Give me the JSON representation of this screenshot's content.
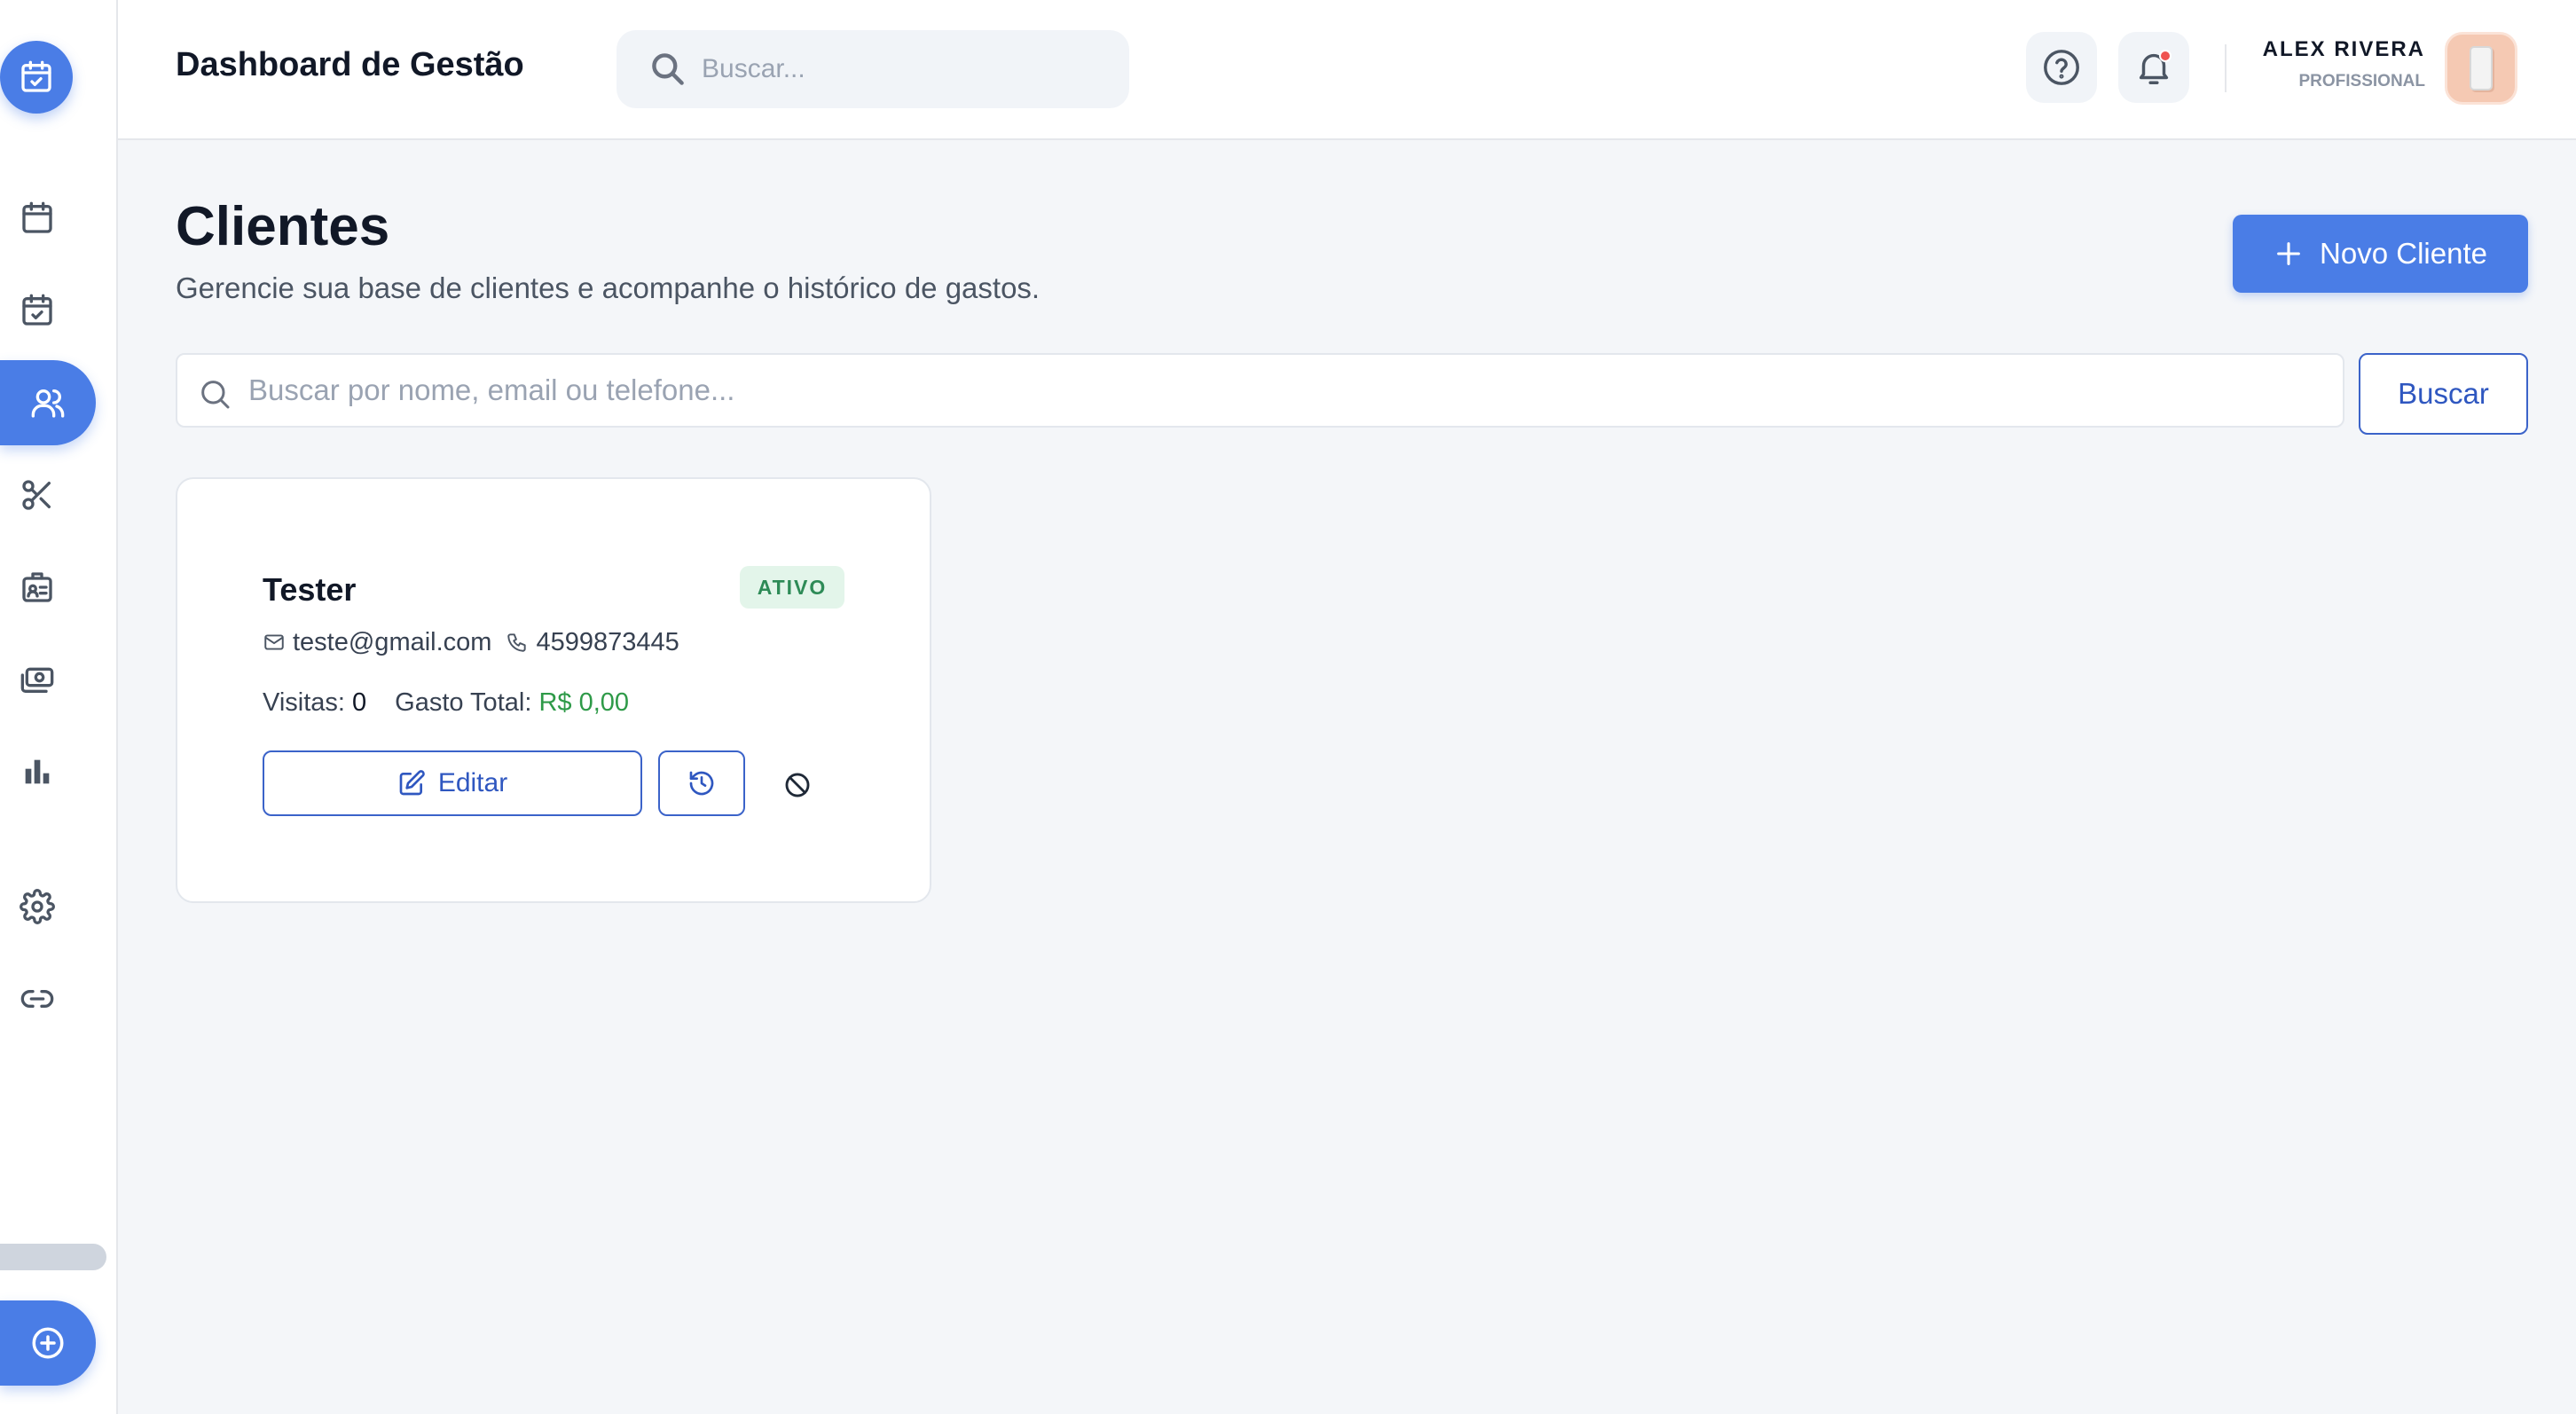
{
  "header": {
    "title": "Dashboard de Gestão",
    "search_placeholder": "Buscar...",
    "user_name": "ALEX RIVERA",
    "user_role": "PROFISSIONAL"
  },
  "sidebar": {
    "items": [
      {
        "icon": "calendar-icon",
        "active": false
      },
      {
        "icon": "calendar-check-icon",
        "active": false
      },
      {
        "icon": "users-icon",
        "active": true
      },
      {
        "icon": "scissors-icon",
        "active": false
      },
      {
        "icon": "id-badge-icon",
        "active": false
      },
      {
        "icon": "money-icon",
        "active": false
      },
      {
        "icon": "bar-chart-icon",
        "active": false
      },
      {
        "icon": "gear-icon",
        "active": false
      },
      {
        "icon": "link-icon",
        "active": false
      }
    ]
  },
  "page": {
    "title": "Clientes",
    "subtitle": "Gerencie sua base de clientes e acompanhe o histórico de gastos.",
    "new_client_label": "Novo Cliente",
    "search_placeholder": "Buscar por nome, email ou telefone...",
    "search_button": "Buscar"
  },
  "clients": [
    {
      "name": "Tester",
      "status": "ATIVO",
      "email": "teste@gmail.com",
      "phone": "4599873445",
      "visits_label": "Visitas:",
      "visits": "0",
      "spent_label": "Gasto Total:",
      "spent": "R$ 0,00",
      "edit_label": "Editar"
    }
  ],
  "colors": {
    "accent": "#4a7de6",
    "accent_dark": "#2f57c0",
    "status_active_bg": "#e3f5ea",
    "status_active_text": "#2e8b57",
    "money": "#2e9a48",
    "notification": "#ef5350"
  }
}
